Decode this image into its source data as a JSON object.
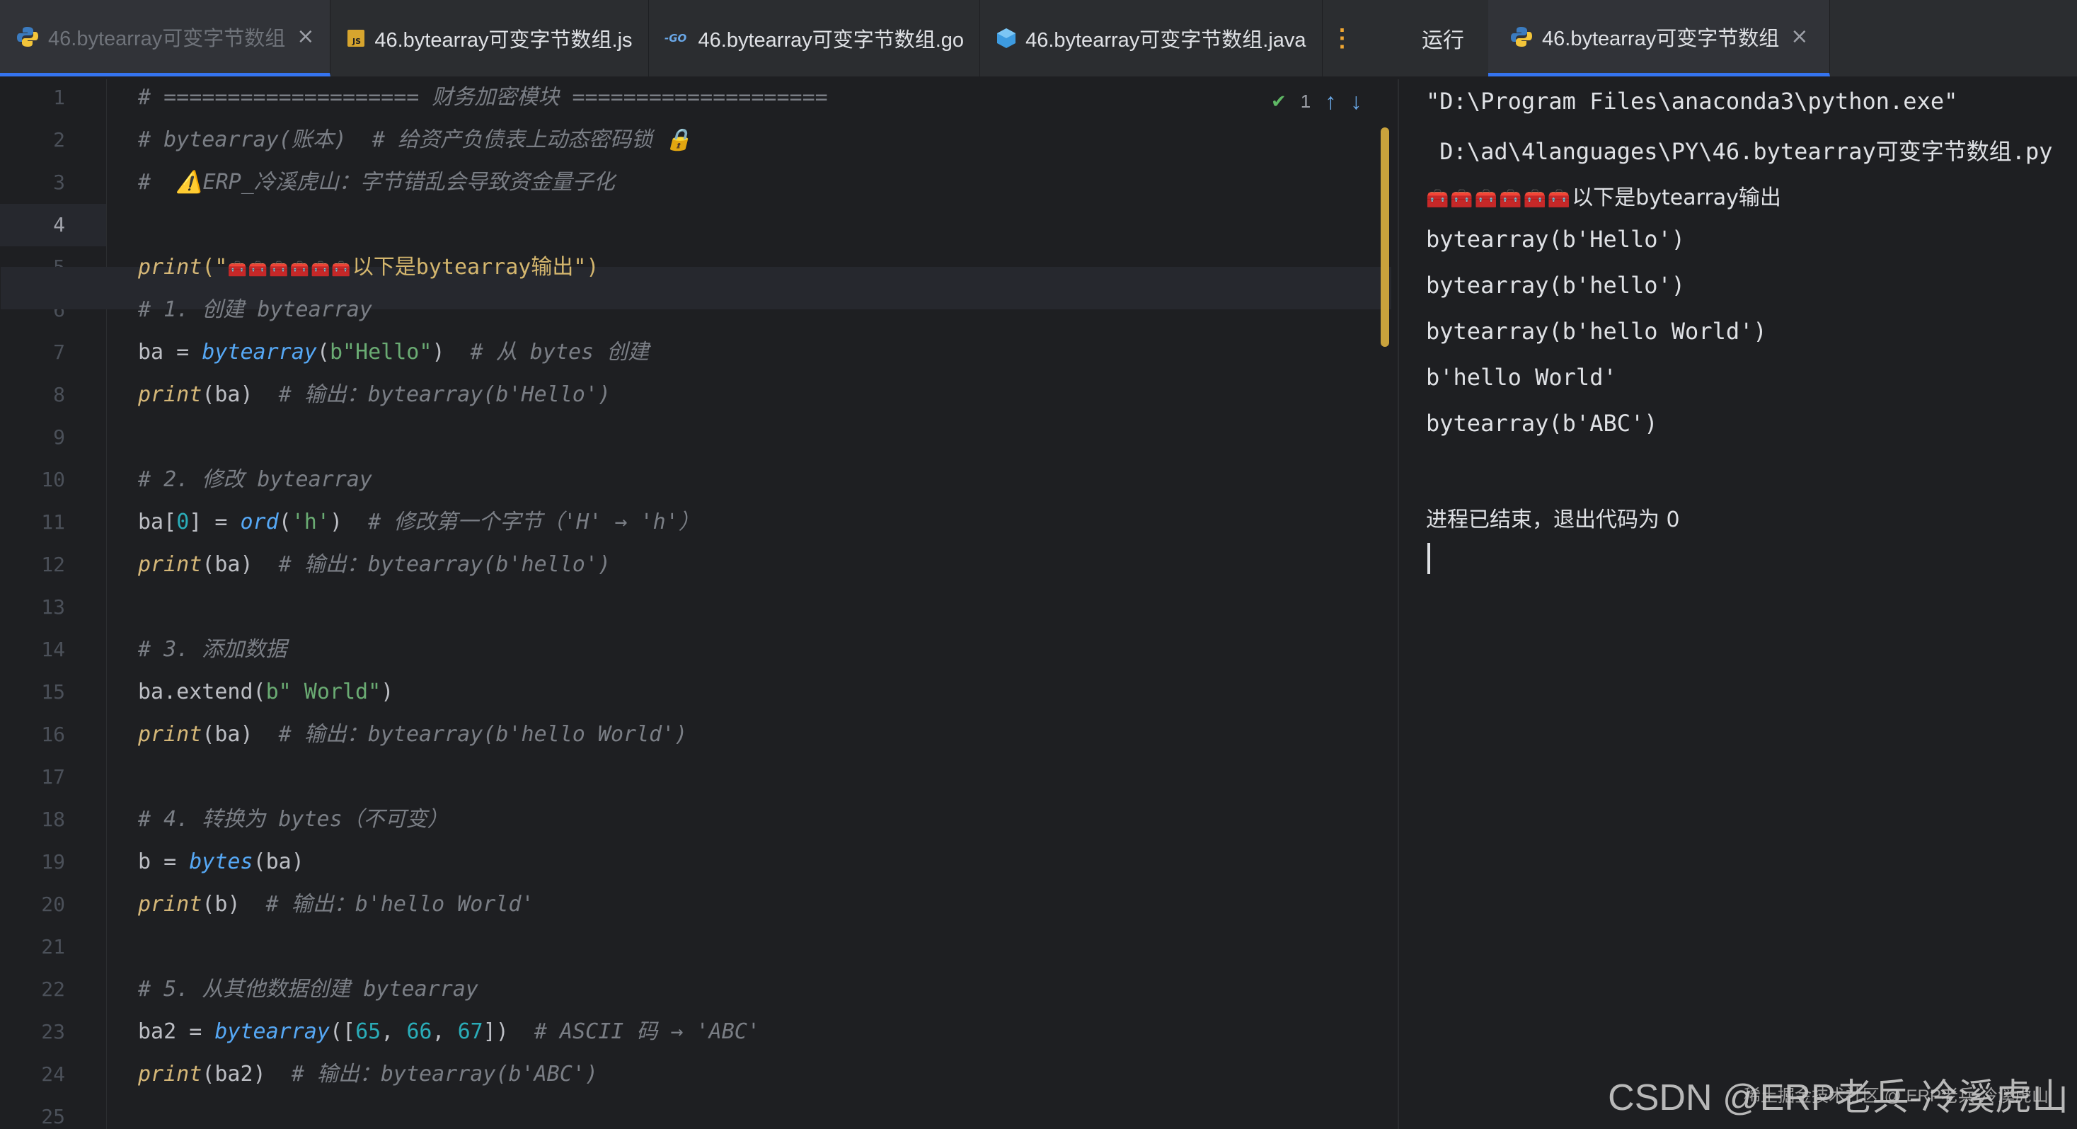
{
  "editor_tabs": [
    {
      "label": "46.bytearray可变字节数组",
      "icon": "python-icon",
      "active": true,
      "close": "×"
    },
    {
      "label": "46.bytearray可变字节数组.js",
      "icon": "js-file-icon",
      "active": false
    },
    {
      "label": "46.bytearray可变字节数组.go",
      "icon": "go-file-icon",
      "active": false
    },
    {
      "label": "46.bytearray可变字节数组.java",
      "icon": "java-file-icon",
      "active": false
    }
  ],
  "editor_more": "⋮",
  "run_panel": {
    "title": "运行",
    "tab_label": "46.bytearray可变字节数组",
    "tab_close": "×"
  },
  "inspection": {
    "count": "1",
    "check_icon": "✔",
    "up_icon": "↑",
    "down_icon": "↓"
  },
  "line_numbers": [
    "1",
    "2",
    "3",
    "4",
    "5",
    "6",
    "7",
    "8",
    "9",
    "10",
    "11",
    "12",
    "13",
    "14",
    "15",
    "16",
    "17",
    "18",
    "19",
    "20",
    "21",
    "22",
    "23",
    "24",
    "25"
  ],
  "code": {
    "l1": "# ==================== 财务加密模块 ====================",
    "l2": "# bytearray(账本)  # 给资产负债表上动态密码锁 🔒",
    "l3": "#  ⚠️ERP_冷溪虎山：字节错乱会导致资金量子化",
    "l5_fn": "print",
    "l5_open": "(\"",
    "l5_emoji": "🧰🧰🧰🧰🧰🧰",
    "l5_text": "以下是bytearray输出",
    "l5_close": "\")",
    "l6": "# 1. 创建 bytearray",
    "l7_id": "ba",
    "l7_op": " = ",
    "l7_fn": "bytearray",
    "l7_arg": "b\"Hello\"",
    "l7_cm": "  # 从 bytes 创建",
    "l8_cm": "  # 输出：bytearray(b'Hello')",
    "l10": "# 2. 修改 bytearray",
    "l11_id": "ba[",
    "l11_num": "0",
    "l11_rest": "] = ",
    "l11_fn": "ord",
    "l11_arg": "'h'",
    "l11_cm": "  # 修改第一个字节（'H' → 'h'）",
    "l12_cm": "  # 输出：bytearray(b'hello')",
    "l14": "# 3. 添加数据",
    "l15_id": "ba",
    "l15_method": ".extend(",
    "l15_arg": "b\" World\"",
    "l16_cm": "  # 输出：bytearray(b'hello World')",
    "l18": "# 4. 转换为 bytes（不可变）",
    "l19_id": "b",
    "l19_fn": "bytes",
    "l19_arg": "ba",
    "l20_cm": "  # 输出：b'hello World'",
    "l22": "# 5. 从其他数据创建 bytearray",
    "l23_id": "ba2",
    "l23_fn": "bytearray",
    "l23_n1": "65",
    "l23_n2": "66",
    "l23_n3": "67",
    "l23_cm": "  # ASCII 码 → 'ABC'",
    "l24_cm": "  # 输出：bytearray(b'ABC')",
    "print": "print",
    "arg_ba": "ba",
    "arg_b": "b",
    "arg_ba2": "ba2"
  },
  "output": {
    "cmd1": "\"D:\\Program Files\\anaconda3\\python.exe\"",
    "cmd2": " D:\\ad\\4languages\\PY\\46.bytearray可变字节数组.py",
    "header_emoji": "🧰🧰🧰🧰🧰🧰",
    "header_text": "以下是bytearray输出",
    "lines": [
      "bytearray(b'Hello')",
      "bytearray(b'hello')",
      "bytearray(b'hello World')",
      "b'hello World'",
      "bytearray(b'ABC')"
    ],
    "exit": "进程已结束，退出代码为 0"
  },
  "watermark": "CSDN @ERP老兵-冷溪虎山",
  "watermark_small": "稀土掘金技术社区 @ ERP老兵-冷溪虎山",
  "colors": {
    "accent": "#3574f0",
    "warning": "#f0a732",
    "scroll_thumb": "#c9a23c"
  }
}
